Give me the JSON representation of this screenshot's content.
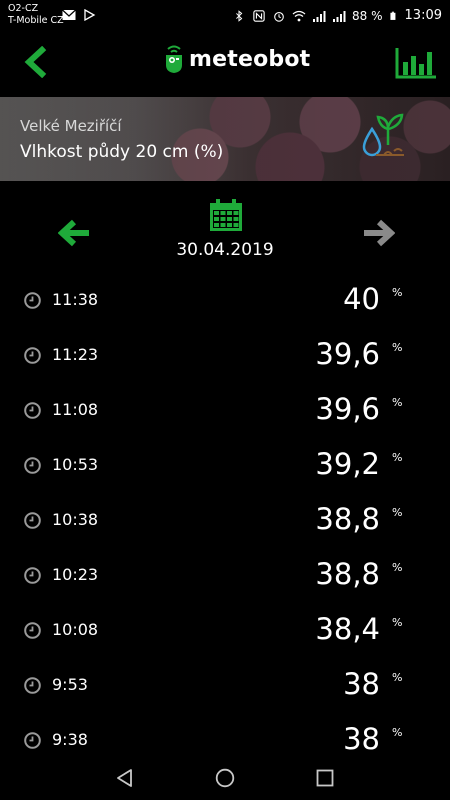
{
  "status_bar": {
    "carrier_line1": "O2-CZ",
    "carrier_line2": "T-Mobile CZ",
    "battery": "88 %",
    "time": "13:09"
  },
  "header": {
    "logo_text": "meteobot"
  },
  "banner": {
    "location": "Velké Meziříčí",
    "sensor": "Vlhkost půdy 20 cm (%)"
  },
  "date_nav": {
    "date": "30.04.2019"
  },
  "readings": [
    {
      "time": "11:38",
      "value": "40",
      "unit": "%"
    },
    {
      "time": "11:23",
      "value": "39,6",
      "unit": "%"
    },
    {
      "time": "11:08",
      "value": "39,6",
      "unit": "%"
    },
    {
      "time": "10:53",
      "value": "39,2",
      "unit": "%"
    },
    {
      "time": "10:38",
      "value": "38,8",
      "unit": "%"
    },
    {
      "time": "10:23",
      "value": "38,8",
      "unit": "%"
    },
    {
      "time": "10:08",
      "value": "38,4",
      "unit": "%"
    },
    {
      "time": "9:53",
      "value": "38",
      "unit": "%"
    },
    {
      "time": "9:38",
      "value": "38",
      "unit": "%"
    }
  ],
  "colors": {
    "accent_green": "#1faa3a",
    "disabled_gray": "#8a8a8a",
    "background": "#000000"
  },
  "icons": {
    "back": "chevron-left-icon",
    "stats": "bar-chart-icon",
    "sensor": "soil-moisture-icon",
    "prev": "arrow-left-icon",
    "next": "arrow-right-icon",
    "calendar": "calendar-icon",
    "row_clock": "clock-icon"
  }
}
